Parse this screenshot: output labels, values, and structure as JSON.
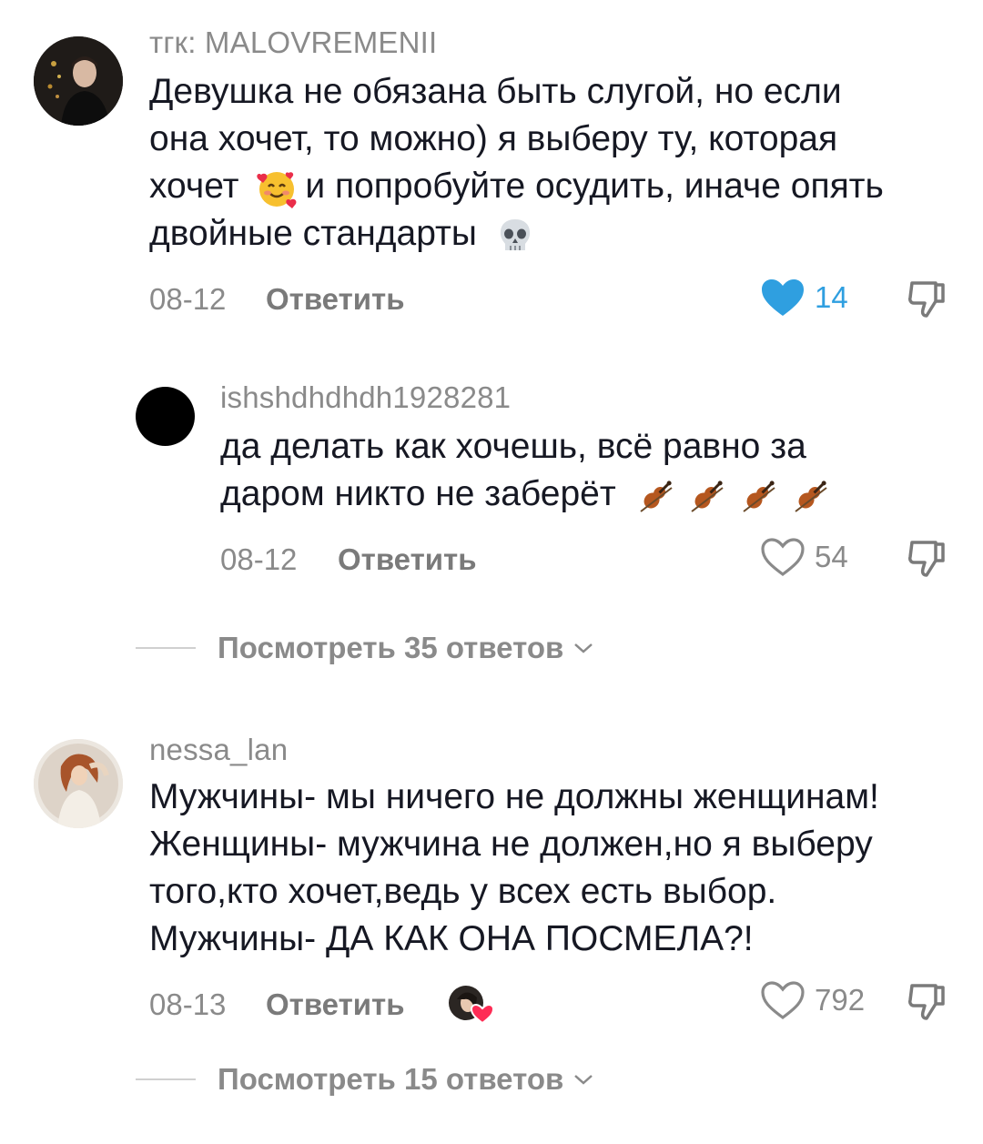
{
  "comments": [
    {
      "username": "тгк: MALOVREMENII",
      "lines": [
        "Девушка не обязана быть слугой, но если",
        "она хочет, то можно) я выберу ту, которая",
        "хочет",
        "и попробуйте осудить, иначе опять",
        "двойные стандарты"
      ],
      "date": "08-12",
      "reply_label": "Ответить",
      "likes": "14",
      "liked": true
    },
    {
      "username": "ishshdhdhdh1928281",
      "lines": [
        "да делать как хочешь, всё равно за",
        "даром никто не заберёт"
      ],
      "date": "08-12",
      "reply_label": "Ответить",
      "likes": "54",
      "liked": false
    },
    {
      "username": "nessa_lan",
      "lines": [
        "Мужчины- мы ничего не должны женщинам!",
        "Женщины- мужчина не должен,но я выберу",
        "того,кто хочет,ведь у всех есть выбор.",
        "Мужчины- ДА КАК ОНА ПОСМЕЛА?!"
      ],
      "date": "08-13",
      "reply_label": "Ответить",
      "likes": "792",
      "liked": false
    }
  ],
  "view_replies": [
    "Посмотреть 35 ответов",
    "Посмотреть 15 ответов"
  ],
  "colors": {
    "text": "#161823",
    "muted": "#8a8a8a",
    "like_active": "#2f9fe0",
    "heart_badge": "#fe2c55"
  },
  "icons": {
    "heart": "heart-icon",
    "dislike": "thumbs-down-icon",
    "chevron": "chevron-down-icon"
  }
}
